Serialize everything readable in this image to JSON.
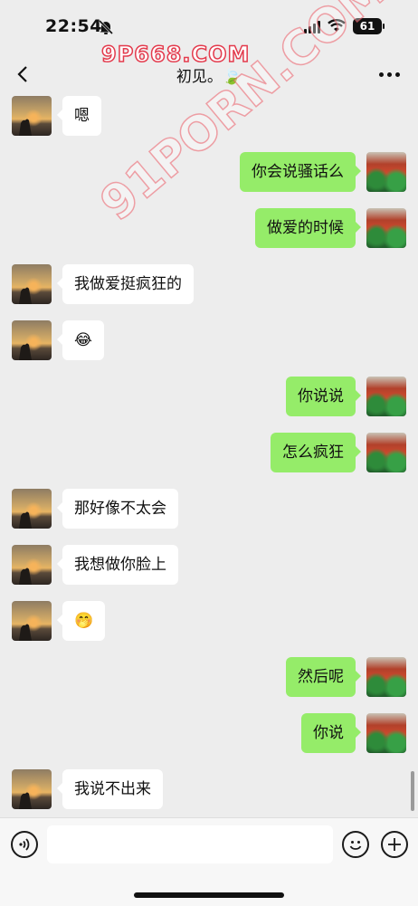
{
  "status": {
    "time": "22:54",
    "battery": "61"
  },
  "watermark": {
    "top": "9P668.COM",
    "diagonal": "91PORN.COM"
  },
  "header": {
    "title": "初见。🍃"
  },
  "messages": [
    {
      "side": "left",
      "text": "嗯"
    },
    {
      "side": "right",
      "text": "你会说骚话么"
    },
    {
      "side": "right",
      "text": "做爱的时候"
    },
    {
      "side": "left",
      "text": "我做爱挺疯狂的"
    },
    {
      "side": "left",
      "text": "😂"
    },
    {
      "side": "right",
      "text": "你说说"
    },
    {
      "side": "right",
      "text": "怎么疯狂"
    },
    {
      "side": "left",
      "text": "那好像不太会"
    },
    {
      "side": "left",
      "text": "我想做你脸上"
    },
    {
      "side": "left",
      "text": "🤭"
    },
    {
      "side": "right",
      "text": "然后呢"
    },
    {
      "side": "right",
      "text": "你说"
    },
    {
      "side": "left",
      "text": "我说不出来"
    }
  ],
  "colors": {
    "bubble_self": "#95ec69",
    "bubble_other": "#ffffff",
    "background": "#ededed"
  },
  "input": {
    "value": "",
    "placeholder": ""
  }
}
